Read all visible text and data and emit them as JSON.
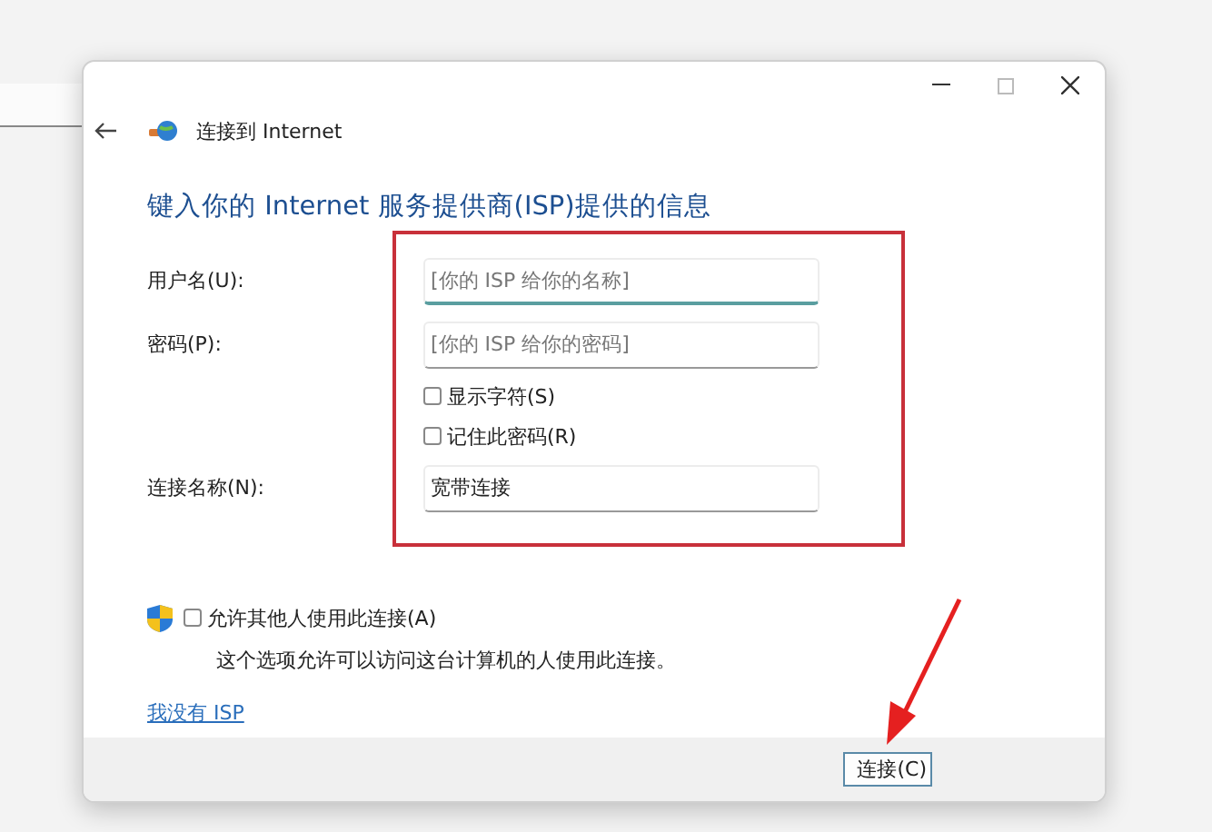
{
  "header": {
    "title": "连接到 Internet"
  },
  "heading": "键入你的 Internet 服务提供商(ISP)提供的信息",
  "fields": [
    {
      "label": "用户名(U):",
      "placeholder": "[你的 ISP 给你的名称]",
      "focused": true
    },
    {
      "label": "密码(P):",
      "placeholder": "[你的 ISP 给你的密码]",
      "focused": false
    }
  ],
  "options": [
    {
      "label": "显示字符(S)",
      "checked": false
    },
    {
      "label": "记住此密码(R)",
      "checked": false
    }
  ],
  "connection_name": {
    "label": "连接名称(N):",
    "value": "宽带连接"
  },
  "share": {
    "label": "允许其他人使用此连接(A)",
    "checked": false,
    "note": "这个选项允许可以访问这台计算机的人使用此连接。"
  },
  "link": "我没有 ISP",
  "buttons": [
    "连接(C)"
  ]
}
